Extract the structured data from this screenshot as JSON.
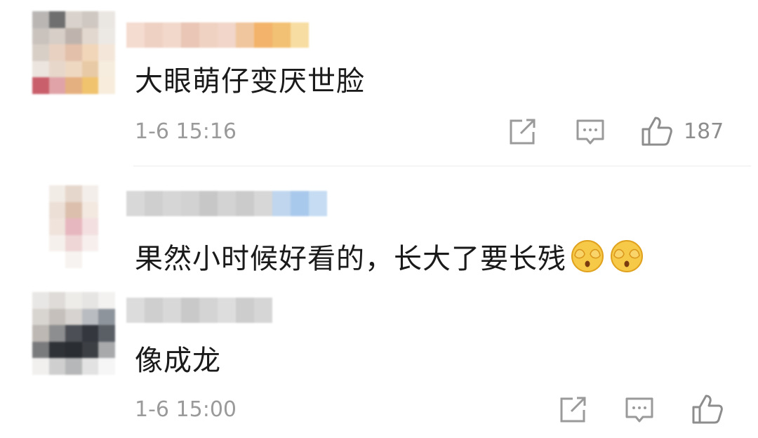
{
  "comments": [
    {
      "username": "",
      "text": "大眼萌仔变厌世脸",
      "time": "1-6 15:16",
      "likes": "187",
      "avatar_colors": [
        "#b9b6b4",
        "#6f6f6f",
        "#d9d2cc",
        "#cfc7c1",
        "#eae6e2",
        "#c9c2bd",
        "#d6cec7",
        "#bfb4ad",
        "#e2d8cf",
        "#ece8e4",
        "#d8cfc7",
        "#e9d1c1",
        "#e2c0aa",
        "#f1d6b9",
        "#f4e7da",
        "#ece5df",
        "#e7d7cb",
        "#eed8c2",
        "#e8cba6",
        "#f6edde",
        "#c95f6b",
        "#e0a4a8",
        "#e5b080",
        "#f0c36e",
        "#f8eddc"
      ],
      "name_colors": [
        "#f4dcd0",
        "#efd1c4",
        "#f2d8cb",
        "#e9c6b6",
        "#f0d2c2",
        "#f1d6c9",
        "#f0c69e",
        "#f3b36a",
        "#f2c173",
        "#f7dda2"
      ]
    },
    {
      "username": "",
      "text": "果然小时候好看的，长大了要长残",
      "emoji": [
        "covering-eyes-emoji",
        "covering-eyes-emoji"
      ],
      "avatar_colors": [
        "#ffffff",
        "#f2ece6",
        "#e6d7cc",
        "#f4eeea",
        "#ffffff",
        "#ffffff",
        "#ebdfd6",
        "#dcc0ad",
        "#f3e9e1",
        "#ffffff",
        "#ffffff",
        "#efe3dc",
        "#e7b7bf",
        "#f3dfe0",
        "#ffffff",
        "#ffffff",
        "#f6f0ec",
        "#eed6d6",
        "#f7efee",
        "#ffffff",
        "#ffffff",
        "#ffffff",
        "#f7f3f0",
        "#ffffff",
        "#ffffff"
      ],
      "name_colors": [
        "#d8d8d8",
        "#cfcfcf",
        "#d6d6d6",
        "#d2d2d2",
        "#c7c7c7",
        "#d3d3d3",
        "#cbcbcb",
        "#d7d7d7",
        "#bfd6ee",
        "#a9c9ec",
        "#c5dcf2"
      ]
    },
    {
      "username": "",
      "text": "像成龙",
      "time": "1-6 15:00",
      "avatar_colors": [
        "#e9e7e5",
        "#dedbd8",
        "#eeece9",
        "#e7e5e3",
        "#f3f2f1",
        "#d8d4d0",
        "#c5c0bb",
        "#d6d3d0",
        "#b9bcc1",
        "#8e949b",
        "#bdb8b3",
        "#8d8e90",
        "#4c4f55",
        "#34383e",
        "#5a5f66",
        "#7a7b7d",
        "#2f3237",
        "#2a2d32",
        "#3c3f44",
        "#a7a9ab",
        "#f1f0ef",
        "#cfcfcf",
        "#b6b7b8",
        "#e2e2e2",
        "#f6f6f6"
      ],
      "name_colors": [
        "#dcdcdc",
        "#cfcfcf",
        "#d8d8d8",
        "#c9c9c9",
        "#d4d4d4",
        "#dddddd",
        "#cdcdcd",
        "#d6d6d6"
      ]
    }
  ],
  "icons": {
    "share": "share-icon",
    "comment": "comment-icon",
    "like": "thumbs-up-icon"
  }
}
